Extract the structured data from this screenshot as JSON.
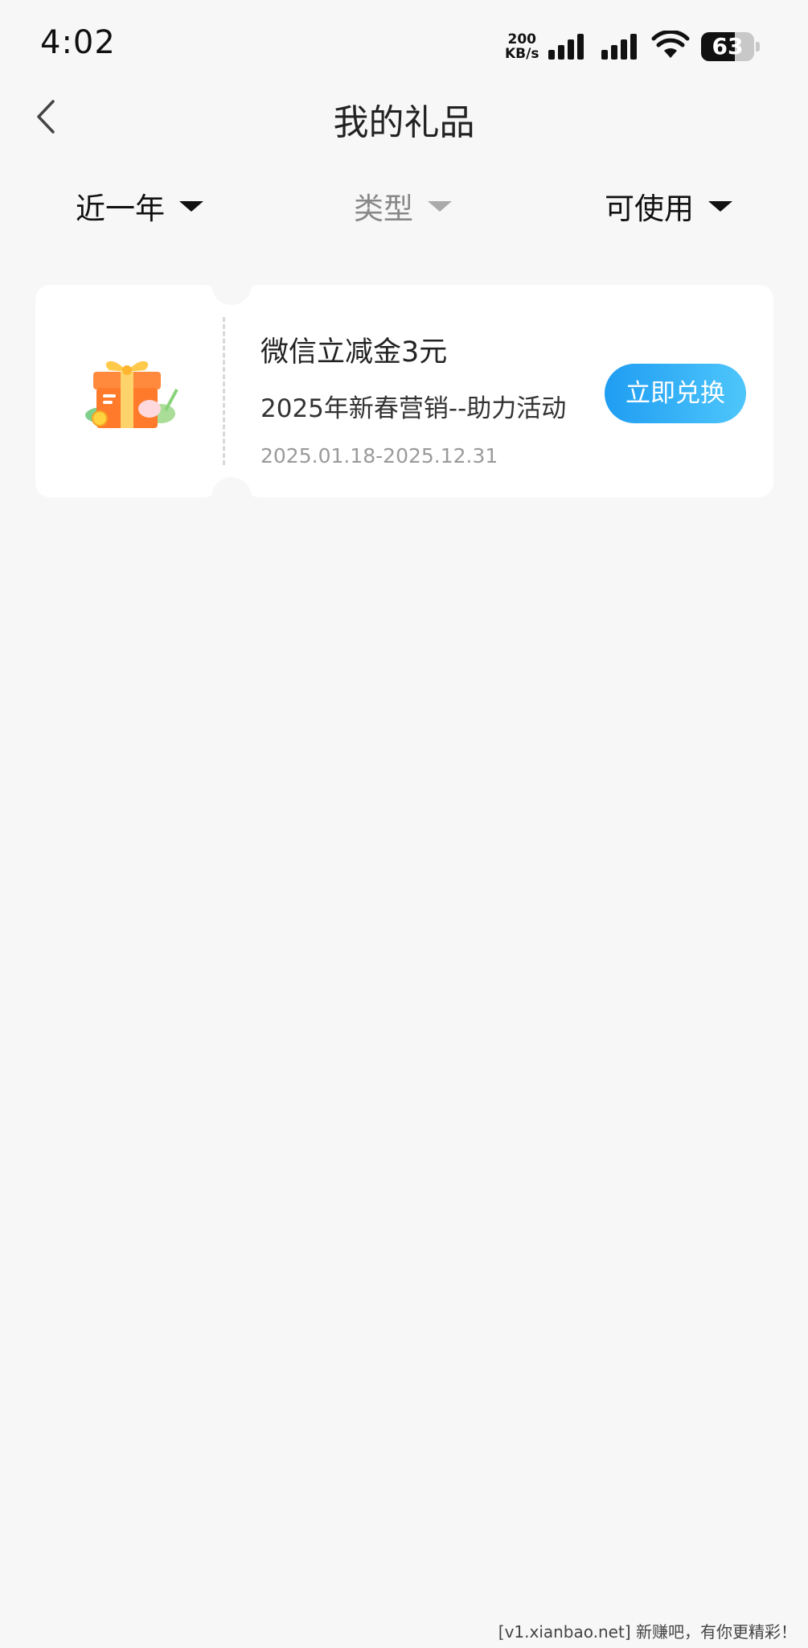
{
  "status_bar": {
    "time": "4:02",
    "net_speed_value": "200",
    "net_speed_unit": "KB/s",
    "battery": 63
  },
  "header": {
    "title": "我的礼品",
    "back_icon": "chevron-left-icon"
  },
  "filters": {
    "period": "近一年",
    "type": "类型",
    "status": "可使用"
  },
  "gifts": [
    {
      "name": "微信立减金3元",
      "campaign": "2025年新春营销--助力活动",
      "valid_period": "2025.01.18-2025.12.31",
      "action_label": "立即兑换",
      "icon": "gift-box-icon"
    }
  ],
  "watermark": "[v1.xianbao.net] 新赚吧，有你更精彩！",
  "colors": {
    "background": "#f7f7f7",
    "button_gradient_start": "#1f9df2",
    "button_gradient_end": "#4ec6fb"
  }
}
